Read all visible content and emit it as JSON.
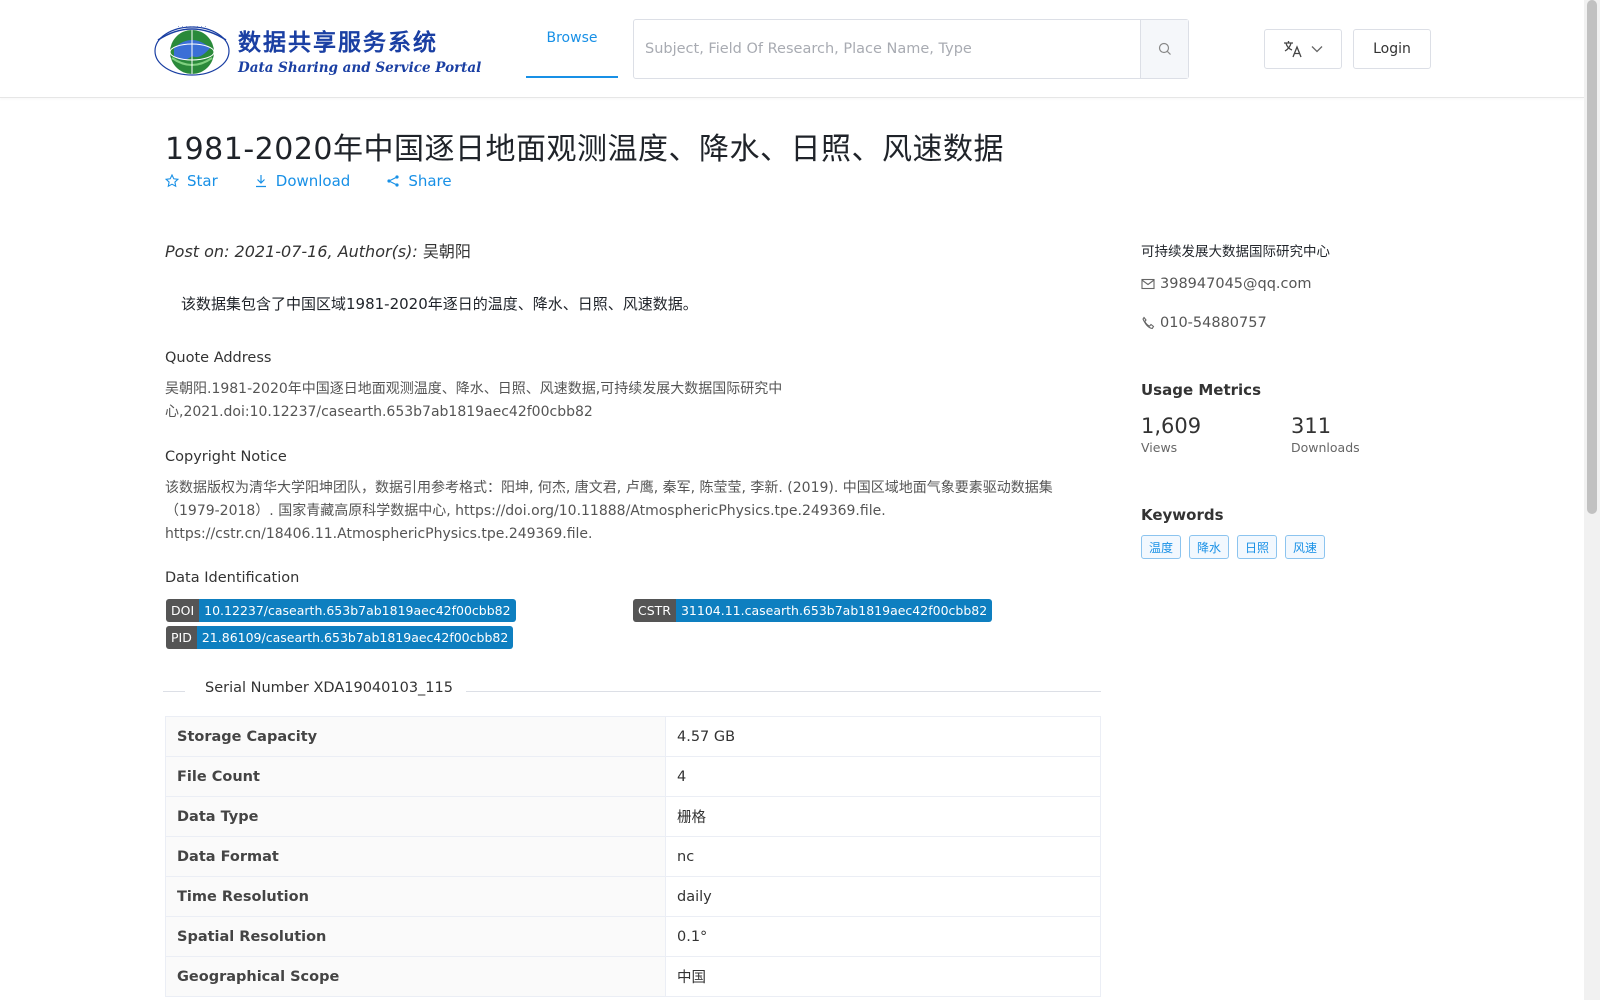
{
  "header": {
    "logo_cn": "数据共享服务系统",
    "logo_en": "Data Sharing and Service Portal",
    "nav_browse": "Browse",
    "search_placeholder": "Subject, Field Of Research, Place Name, Type",
    "login_label": "Login"
  },
  "dataset": {
    "title": "1981-2020年中国逐日地面观测温度、降水、日照、风速数据",
    "actions": {
      "star": "Star",
      "download": "Download",
      "share": "Share"
    },
    "posted_prefix": "Post on: 2021-07-16, Author(s): ",
    "author": "吴朝阳",
    "description": "该数据集包含了中国区域1981-2020年逐日的温度、降水、日照、风速数据。",
    "quote": {
      "title": "Quote Address",
      "line1": "吴朝阳.1981-2020年中国逐日地面观测温度、降水、日照、风速数据,可持续发展大数据国际研究中",
      "line2": "心,2021.doi:10.12237/casearth.653b7ab1819aec42f00cbb82"
    },
    "copyright": {
      "title": "Copyright Notice",
      "line1": "该数据版权为清华大学阳坤团队，数据引用参考格式：阳坤, 何杰, 唐文君, 卢鹰, 秦军, 陈莹莹, 李新. (2019). 中国区域地面气象要素驱动数据集",
      "line2": "（1979-2018）. 国家青藏高原科学数据中心, https://doi.org/10.11888/AtmosphericPhysics.tpe.249369.file.",
      "line3": "https://cstr.cn/18406.11.AtmosphericPhysics.tpe.249369.file."
    },
    "identification": {
      "title": "Data Identification",
      "doi_key": "DOI",
      "doi_val": "10.12237/casearth.653b7ab1819aec42f00cbb82",
      "cstr_key": "CSTR",
      "cstr_val": "31104.11.casearth.653b7ab1819aec42f00cbb82",
      "pid_key": "PID",
      "pid_val": "21.86109/casearth.653b7ab1819aec42f00cbb82"
    },
    "serial": "Serial Number XDA19040103_115",
    "table": [
      {
        "label": "Storage Capacity",
        "value": "4.57 GB"
      },
      {
        "label": "File Count",
        "value": "4"
      },
      {
        "label": "Data Type",
        "value": "栅格"
      },
      {
        "label": "Data Format",
        "value": "nc"
      },
      {
        "label": "Time Resolution",
        "value": "daily"
      },
      {
        "label": "Spatial Resolution",
        "value": "0.1°"
      },
      {
        "label": "Geographical Scope",
        "value": "中国"
      }
    ]
  },
  "sidebar": {
    "org": "可持续发展大数据国际研究中心",
    "email": "398947045@qq.com",
    "phone": "010-54880757",
    "metrics_title": "Usage Metrics",
    "views_num": "1,609",
    "views_label": "Views",
    "downloads_num": "311",
    "downloads_label": "Downloads",
    "keywords_title": "Keywords",
    "keywords": [
      "温度",
      "降水",
      "日照",
      "风速"
    ]
  },
  "colors": {
    "accent": "#1890e6",
    "badge_value": "#0e7fc0",
    "badge_key": "#555555"
  }
}
